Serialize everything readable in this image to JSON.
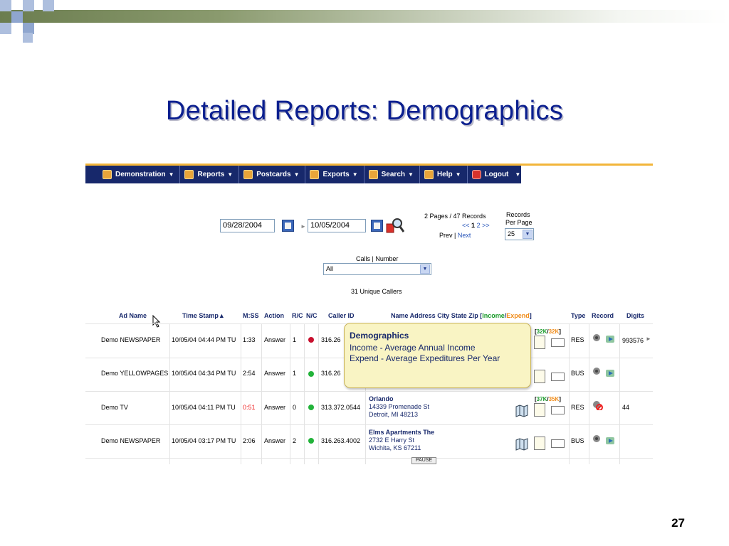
{
  "slide": {
    "title": "Detailed Reports:  Demographics",
    "page_number": "27"
  },
  "menu": {
    "items": [
      {
        "label": "Demonstration",
        "icon": "demo-icon"
      },
      {
        "label": "Reports",
        "icon": "reports-icon"
      },
      {
        "label": "Postcards",
        "icon": "postcards-icon"
      },
      {
        "label": "Exports",
        "icon": "exports-icon"
      },
      {
        "label": "Search",
        "icon": "search-icon"
      },
      {
        "label": "Help",
        "icon": "help-icon"
      },
      {
        "label": "Logout",
        "icon": "logout-icon"
      }
    ]
  },
  "filters": {
    "start_date": "09/28/2004",
    "end_date": "10/05/2004",
    "pages_records": "2 Pages / 47 Records",
    "pager_prev_arrows": "<<",
    "pager_current": "1",
    "pager_next_page": "2",
    "pager_next_arrows": ">>",
    "prev_label": "Prev",
    "pipe": "|",
    "next_label": "Next",
    "records_per_page_line1": "Records",
    "records_per_page_line2": "Per Page",
    "records_per_page_value": "25",
    "calls_label": "Calls | Number",
    "calls_value": "All",
    "unique_callers": "31 Unique Callers"
  },
  "table": {
    "headers": {
      "ad_name": "Ad Name",
      "time_stamp": "Time Stamp",
      "mss": "M:SS",
      "action": "Action",
      "rc": "R/C",
      "nc": "N/C",
      "caller_id": "Caller ID",
      "name_address_prefix": "Name Address City State Zip [",
      "income": "Income",
      "slash": "/",
      "expend": "Expend",
      "name_address_suffix": "]",
      "type": "Type",
      "record": "Record",
      "digits": "Digits"
    },
    "rows": [
      {
        "ad_name": "Demo NEWSPAPER",
        "time": "10/05/04 04:44 PM TU",
        "mss": "1:33",
        "mss_color": "normal",
        "action": "Answer",
        "rc": "1",
        "nc_color": "#c8102e",
        "caller_id": "316.26",
        "name": "",
        "street": "",
        "city": "",
        "inc_open": "[",
        "income": "32K",
        "inc_slash": "/",
        "expend": "32K",
        "inc_close": "]",
        "type": "RES",
        "digits": "993576"
      },
      {
        "ad_name": "Demo YELLOWPAGES",
        "time": "10/05/04 04:34 PM TU",
        "mss": "2:54",
        "mss_color": "normal",
        "action": "Answer",
        "rc": "1",
        "nc_color": "#22b33a",
        "caller_id": "316.26",
        "name": "",
        "street": "",
        "city": "",
        "inc_open": "",
        "income": "",
        "inc_slash": "",
        "expend": "",
        "inc_close": "",
        "type": "BUS",
        "digits": ""
      },
      {
        "ad_name": "Demo TV",
        "time": "10/05/04 04:11 PM TU",
        "mss": "0:51",
        "mss_color": "red",
        "action": "Answer",
        "rc": "0",
        "nc_color": "#22b33a",
        "caller_id": "313.372.0544",
        "name": "Orlando",
        "street": "14339 Promenade St",
        "city": "Detroit, MI 48213",
        "inc_open": "[",
        "income": "37K",
        "inc_slash": "/",
        "expend": "35K",
        "inc_close": "]",
        "type": "RES",
        "digits": "44"
      },
      {
        "ad_name": "Demo NEWSPAPER",
        "time": "10/05/04 03:17 PM TU",
        "mss": "2:06",
        "mss_color": "normal",
        "action": "Answer",
        "rc": "2",
        "nc_color": "#22b33a",
        "caller_id": "316.263.4002",
        "name": "Elms Apartments The",
        "street": "2732 E Harry St",
        "city": "Wichita, KS 67211",
        "inc_open": "",
        "income": "",
        "inc_slash": "",
        "expend": "",
        "inc_close": "",
        "type": "BUS",
        "digits": ""
      }
    ]
  },
  "popup": {
    "title": "Demographics",
    "line1": "Income - Average Annual Income",
    "line2": "Expend - Average Expeditures Per Year"
  },
  "pause_label": "PAUSE",
  "colors": {
    "menubar": "#17286b",
    "title": "#0b1f8f",
    "income": "#1a9b2a",
    "expend": "#f08c1a",
    "popup_bg": "#f9f4c4"
  }
}
